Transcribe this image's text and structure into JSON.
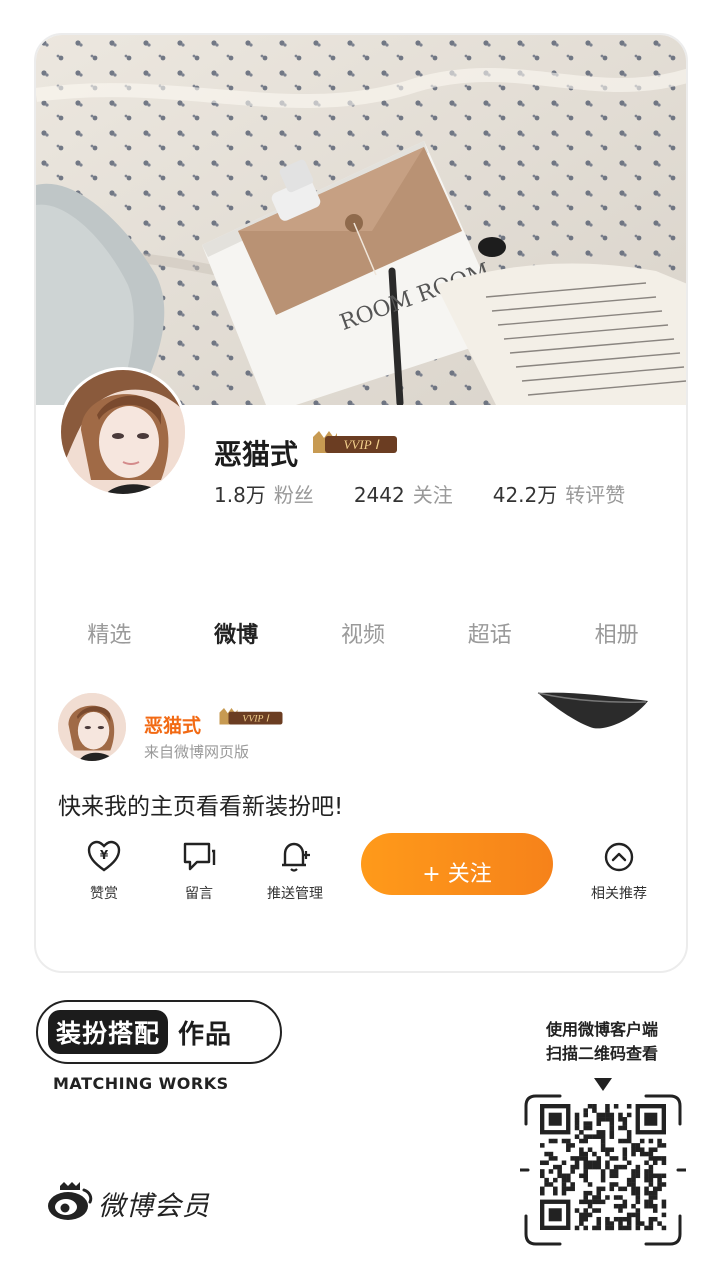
{
  "profile": {
    "name": "恶猫式",
    "vvip_badge": "VVIP Ⅰ",
    "stats": [
      {
        "value": "1.8万",
        "label": "粉丝"
      },
      {
        "value": "2442",
        "label": "关注"
      },
      {
        "value": "42.2万",
        "label": "转评赞"
      }
    ]
  },
  "tabs": [
    "精选",
    "微博",
    "视频",
    "超话",
    "相册"
  ],
  "active_tab": "微博",
  "post": {
    "author": "恶猫式",
    "vvip_badge": "VVIP Ⅰ",
    "source": "来自微博网页版",
    "text": "快来我的主页看看新装扮吧!"
  },
  "actions": [
    {
      "label": "赞赏",
      "icon": "reward-heart-icon"
    },
    {
      "label": "留言",
      "icon": "comment-icon"
    },
    {
      "label": "推送管理",
      "icon": "bell-plus-icon"
    },
    {
      "label": "相关推荐",
      "icon": "chevron-up-circle-icon"
    }
  ],
  "follow_button": "+ 关注",
  "footer": {
    "badge_dark": "装扮搭配",
    "badge_light": "作品",
    "subtitle": "MATCHING WORKS",
    "brand": "微博会员",
    "scan_line1": "使用微博客户端",
    "scan_line2": "扫描二维码查看"
  },
  "colors": {
    "accent_orange": "#f6821a",
    "name_orange": "#f26a14",
    "vvip_gold": "#c79a52"
  }
}
